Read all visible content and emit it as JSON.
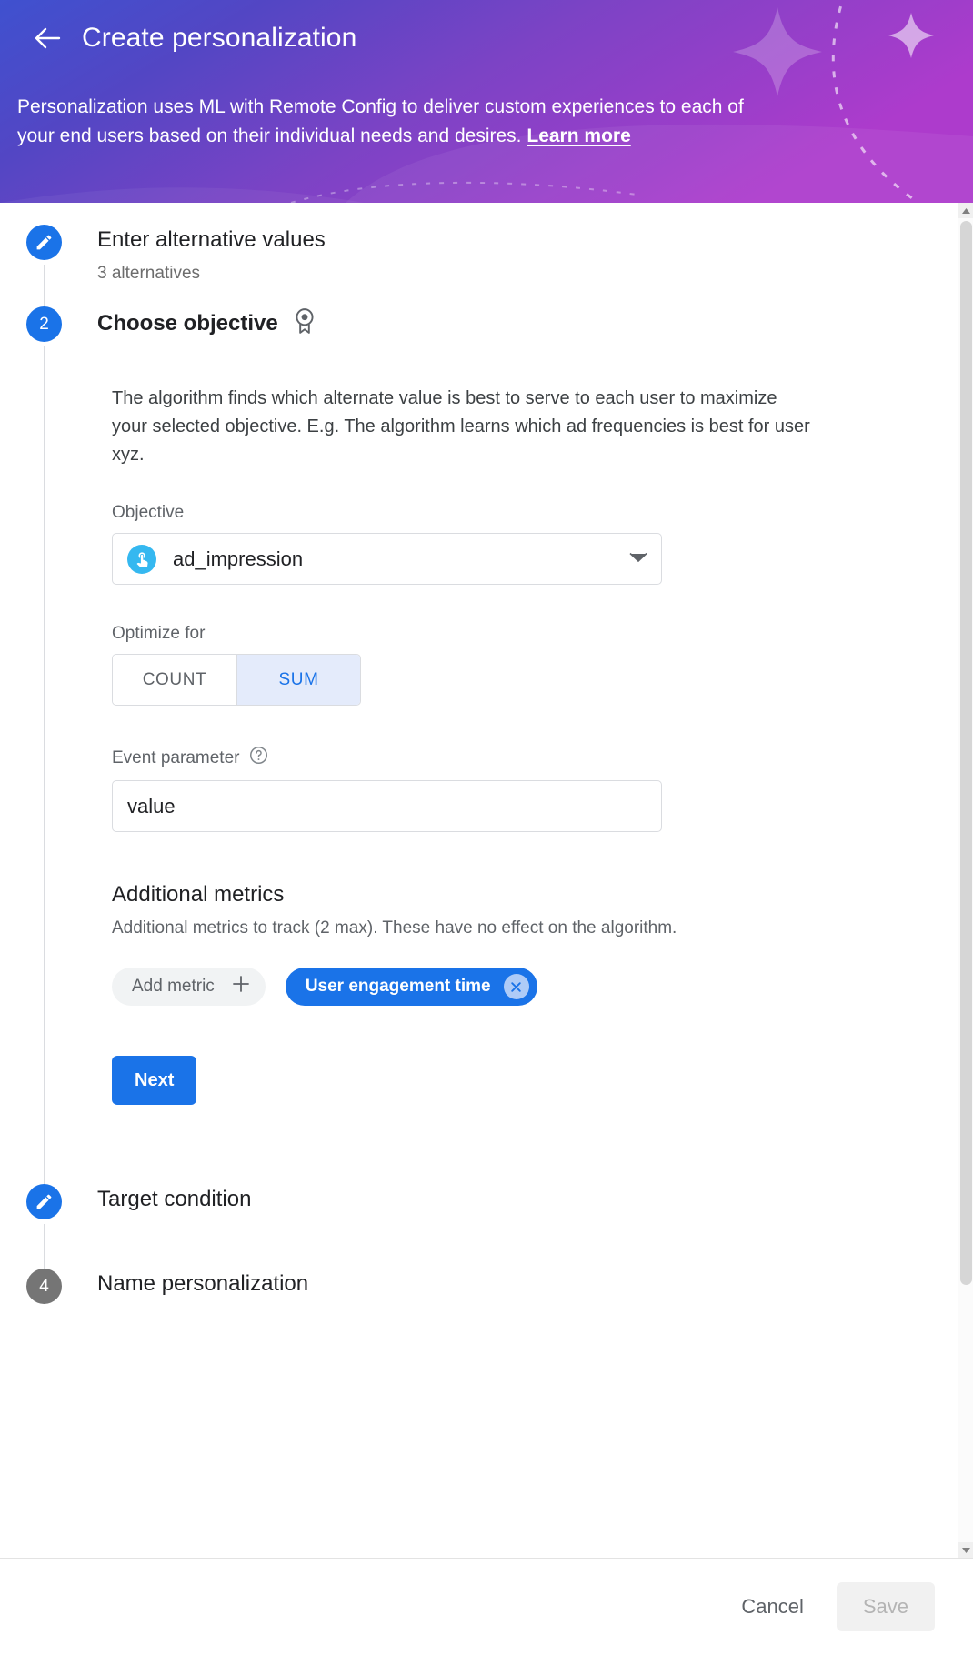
{
  "header": {
    "back_icon": "arrow-left-icon",
    "title": "Create personalization",
    "description_before": "Personalization uses ML with Remote Config to deliver custom experiences to each of your end users based on their individual needs and desires.",
    "learn_more": "Learn more"
  },
  "steps": [
    {
      "index": "1",
      "marker": "pencil-icon",
      "title": "Enter alternative values",
      "subtitle": "3 alternatives"
    },
    {
      "index": "2",
      "marker": "2",
      "title": "Choose objective",
      "icon": "medal-award-icon"
    },
    {
      "index": "3",
      "marker": "pencil-icon",
      "title": "Target condition"
    },
    {
      "index": "4",
      "marker": "4",
      "title": "Name personalization"
    }
  ],
  "objective_step": {
    "description": "The algorithm finds which alternate value is best to serve to each user to maximize your selected objective. E.g. The algorithm learns which ad frequencies is best for user xyz.",
    "objective_label": "Objective",
    "objective_value": "ad_impression",
    "objective_icon": "touch-app-icon",
    "dropdown_icon": "chevron-down-icon",
    "optimize_label": "Optimize for",
    "optimize_options": [
      "COUNT",
      "SUM"
    ],
    "optimize_selected": "SUM",
    "event_param_label": "Event parameter",
    "event_param_help_icon": "help-circle-icon",
    "event_param_value": "value",
    "additional_title": "Additional metrics",
    "additional_sub": "Additional metrics to track (2 max). These have no effect on the algorithm.",
    "add_metric_label": "Add metric",
    "add_metric_icon": "plus-icon",
    "selected_metric": "User engagement time",
    "remove_metric_icon": "close-circle-icon",
    "next_label": "Next"
  },
  "footer": {
    "cancel": "Cancel",
    "save": "Save"
  },
  "colors": {
    "accent_blue": "#1a73e8",
    "step_grey": "#757575",
    "objective_icon_blue": "#35b8f0",
    "toggle_selected_bg": "#e4ebfb",
    "header_gradient_start": "#3f51cf",
    "header_gradient_end": "#a83ccb"
  },
  "scrollbar": {
    "up_arrow": "scroll-up-arrow",
    "down_arrow": "scroll-down-arrow"
  }
}
